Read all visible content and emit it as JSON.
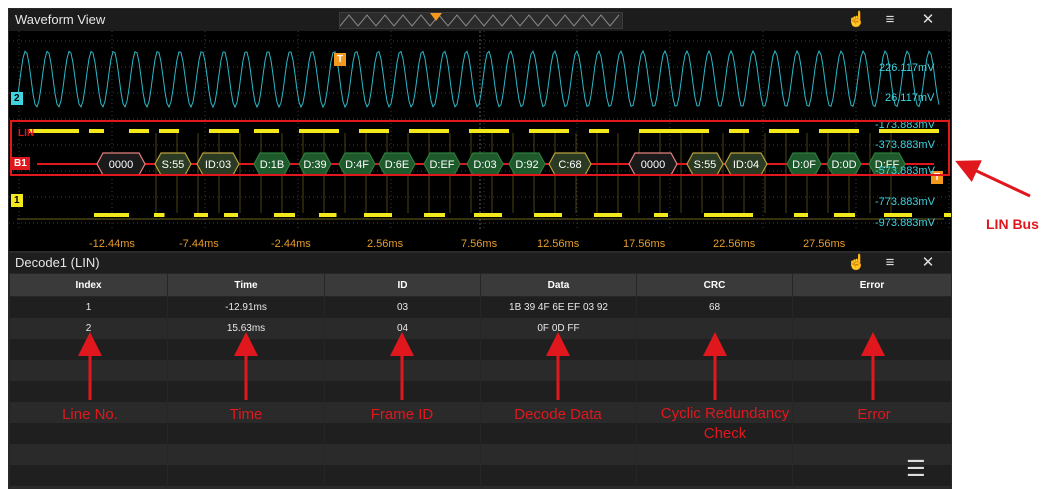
{
  "waveform": {
    "title": "Waveform View",
    "trigger_label": "T",
    "ch2_tag": "2",
    "ch1_tag": "1",
    "bus_tag": "B1",
    "lin_label": "LIN",
    "voltages": [
      "226.117mV",
      "26.117mV",
      "-173.883mV",
      "-373.883mV",
      "-573.883mV",
      "-773.883mV",
      "-973.883mV"
    ],
    "times": [
      "-12.44ms",
      "-7.44ms",
      "-2.44ms",
      "2.56ms",
      "7.56ms",
      "12.56ms",
      "17.56ms",
      "22.56ms",
      "27.56ms"
    ],
    "packets": [
      "0000",
      "S:55",
      "ID:03",
      "D:1B",
      "D:39",
      "D:4F",
      "D:6E",
      "D:EF",
      "D:03",
      "D:92",
      "C:68",
      "0000",
      "S:55",
      "ID:04",
      "D:0F",
      "D:0D",
      "D:FF"
    ],
    "icons": [
      "touch-icon",
      "menu-icon",
      "close-icon"
    ],
    "colors": {
      "ch2": "#3fd4e0",
      "ch1": "#f2e81c",
      "trigger": "#f39a1e",
      "bus": "#e0181e"
    }
  },
  "decode": {
    "title": "Decode1 (LIN)",
    "columns": [
      "Index",
      "Time",
      "ID",
      "Data",
      "CRC",
      "Error"
    ],
    "rows": [
      [
        "1",
        "-12.91ms",
        "03",
        "1B 39 4F 6E EF 03 92",
        "68",
        ""
      ],
      [
        "2",
        "15.63ms",
        "04",
        "0F 0D FF",
        "",
        ""
      ]
    ]
  },
  "annotations": {
    "line_no": "Line No.",
    "time": "Time",
    "frame_id": "Frame ID",
    "decode_data": "Decode Data",
    "crc": "Cyclic Redundancy Check",
    "error": "Error",
    "lin_bus": "LIN Bus"
  }
}
